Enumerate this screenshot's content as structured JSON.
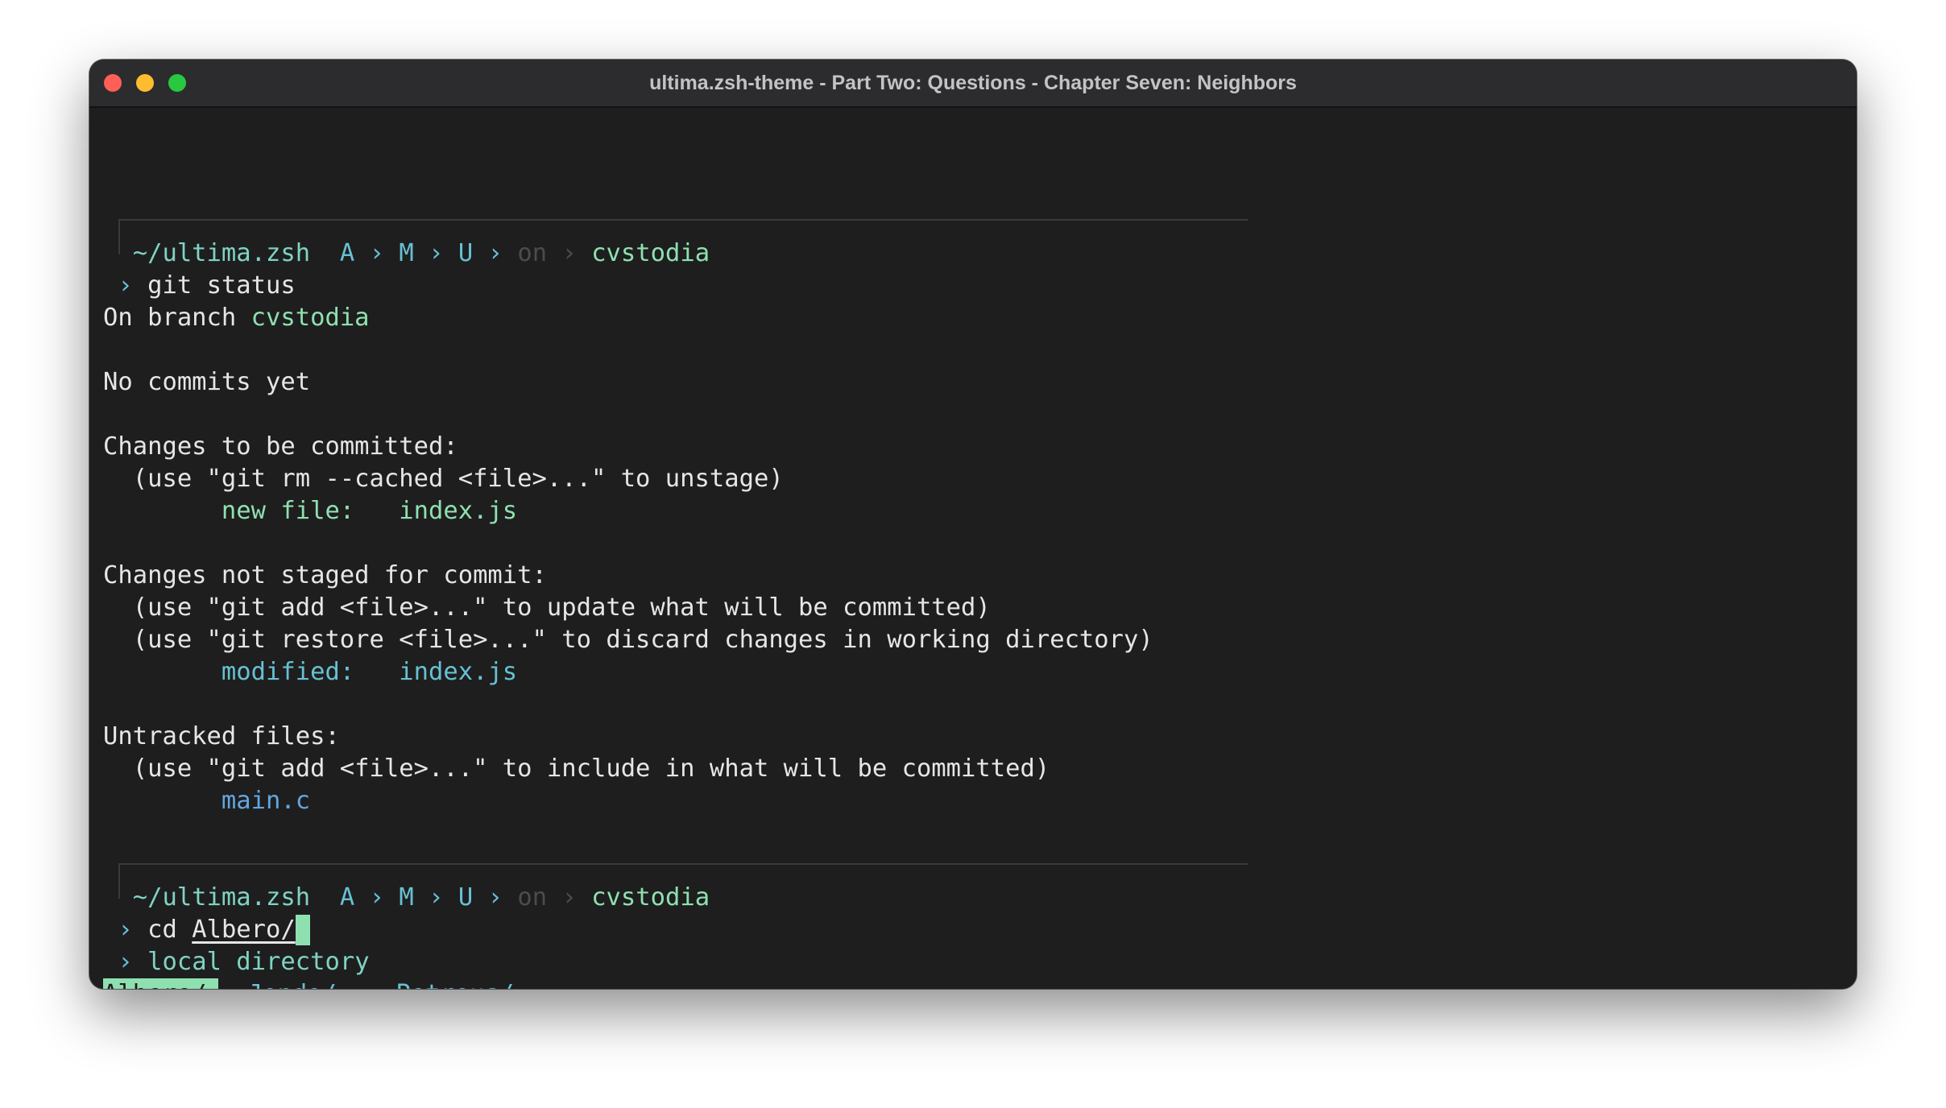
{
  "window": {
    "title": "ultima.zsh-theme - Part Two: Questions - Chapter Seven: Neighbors"
  },
  "prompt1": {
    "path": "~/ultima.zsh",
    "status_a": "A",
    "status_m": "M",
    "status_u": "U",
    "sep": "›",
    "on": "on",
    "branch": "cvstodia",
    "arrow": "›",
    "command": "git status"
  },
  "output": {
    "on_branch_label": "On branch ",
    "on_branch_name": "cvstodia",
    "no_commits": "No commits yet",
    "staged_header": "Changes to be committed:",
    "staged_hint": "  (use \"git rm --cached <file>...\" to unstage)",
    "staged_kind": "        new file:   ",
    "staged_file": "index.js",
    "unstaged_header": "Changes not staged for commit:",
    "unstaged_hint1": "  (use \"git add <file>...\" to update what will be committed)",
    "unstaged_hint2": "  (use \"git restore <file>...\" to discard changes in working directory)",
    "unstaged_kind": "        modified:   ",
    "unstaged_file": "index.js",
    "untracked_header": "Untracked files:",
    "untracked_hint": "  (use \"git add <file>...\" to include in what will be committed)",
    "untracked_file": "main.c"
  },
  "prompt2": {
    "path": "~/ultima.zsh",
    "status_a": "A",
    "status_m": "M",
    "status_u": "U",
    "sep": "›",
    "on": "on",
    "branch": "cvstodia",
    "arrow": "›",
    "command": "cd ",
    "argument": "Albero/",
    "completion_arrow": "›",
    "completion_label": "local directory",
    "completions": [
      "Albero/",
      "Jondo/",
      "Petrous/"
    ]
  },
  "colors": {
    "background": "#1e1e1e",
    "path": "#7fd3c4",
    "status": "#67c1d3",
    "branch": "#8fe0b0",
    "untracked": "#62a6e0",
    "selection": "#8fe0b0"
  }
}
